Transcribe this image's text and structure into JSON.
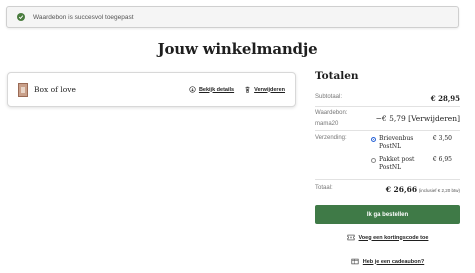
{
  "notice": {
    "message": "Waardebon is succesvol toegepast",
    "icon": "check-circle-icon"
  },
  "page_title": "Jouw winkelmandje",
  "cart": {
    "items": [
      {
        "name": "Box of love",
        "view_label": "Bekijk details",
        "remove_label": "Verwijderen"
      }
    ]
  },
  "totals": {
    "title": "Totalen",
    "subtotal_label": "Subtotaal:",
    "subtotal_value": "€ 28,95",
    "voucher_label": "Waardebon:",
    "voucher_code": "mama20",
    "voucher_value": "−€ 5,79",
    "voucher_remove": "[Verwijderen]",
    "shipping_label": "Verzending:",
    "shipping_options": [
      {
        "name": "Brievenbus PostNL",
        "price": "€ 3,50",
        "selected": true
      },
      {
        "name": "Pakket post PostNL",
        "price": "€ 6,95",
        "selected": false
      }
    ],
    "total_label": "Totaal:",
    "total_value": "€ 26,66",
    "tax_note": "(inclusief € 2,20 btw)"
  },
  "checkout_label": "Ik ga bestellen",
  "coupon_link": "Voeg een kortingscode toe",
  "giftcard_link": "Heb je een cadeaubon?",
  "colors": {
    "accent_green": "#3f7a47",
    "radio_blue": "#2a64d6"
  }
}
